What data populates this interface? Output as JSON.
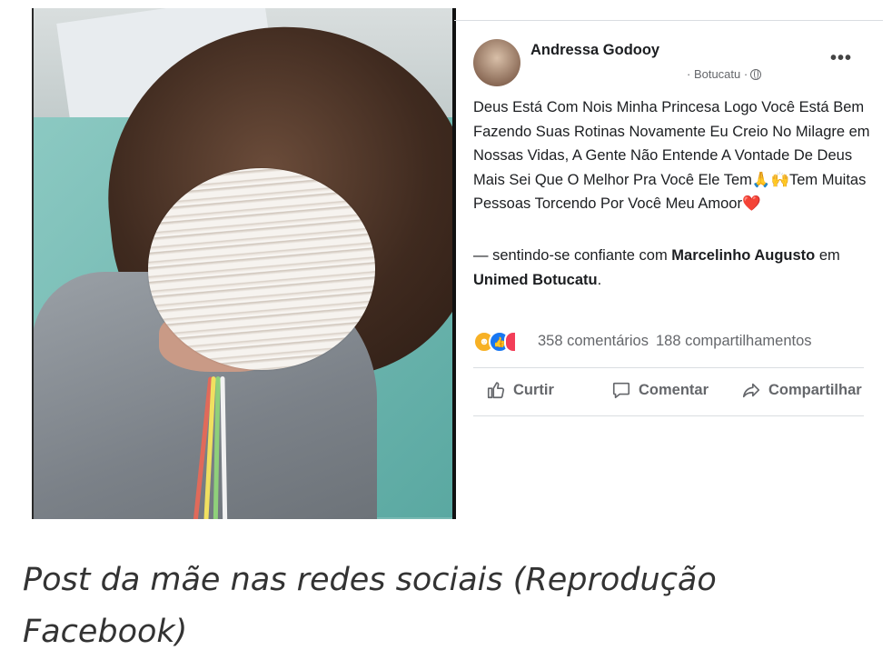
{
  "post": {
    "author": "Andressa Godooy",
    "location_meta": "· Botucatu ·",
    "more_label": "•••",
    "body": "Deus Está Com Nois Minha Princesa Logo Você Está Bem Fazendo Suas Rotinas Novamente Eu Creio No Milagre em Nossas Vidas, A Gente Não Entende A Vontade De Deus Mais Sei Que O Melhor Pra Você Ele Tem🙏🙌Tem Muitas Pessoas Torcendo Por Você Meu Amoor❤️",
    "feeling_prefix": "— sentindo-se confiante com ",
    "tagged_person": "Marcelinho Augusto",
    "feeling_mid": " em ",
    "place": "Unimed Botucatu",
    "feeling_suffix": ".",
    "reactions": [
      "care-icon",
      "like-icon",
      "love-icon"
    ],
    "comments": "358 comentários",
    "shares": "188 compartilhamentos"
  },
  "actions": {
    "like": "Curtir",
    "comment": "Comentar",
    "share": "Compartilhar"
  },
  "caption": "Post da mãe nas redes sociais (Reprodução Facebook)",
  "colors": {
    "link_blue": "#1877f2",
    "meta_gray": "#65676b",
    "caption_gray": "#333333"
  }
}
